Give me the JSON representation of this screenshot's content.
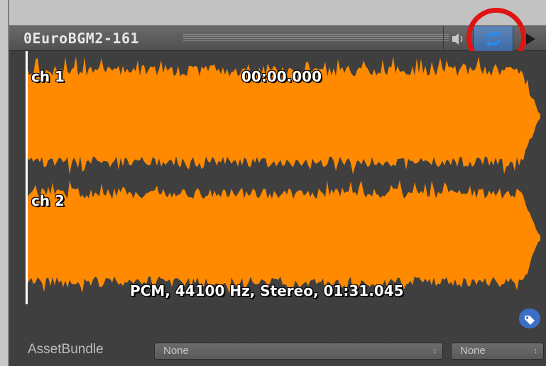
{
  "header": {
    "title": "0EuroBGM2-161",
    "buttons": [
      "mute-toggle",
      "loop-toggle",
      "play-button"
    ],
    "highlighted_button": "loop-toggle",
    "annotation": "red-circle"
  },
  "preview": {
    "channels": [
      {
        "label": "ch 1"
      },
      {
        "label": "ch 2"
      }
    ],
    "time": "00:00.000",
    "info": "PCM, 44100 Hz, Stereo, 01:31.045",
    "waveform_color": "#ff8a00",
    "background_color": "#3f3f3f"
  },
  "footer": {
    "assetbundle_label": "AssetBundle",
    "bundle_name": {
      "value": "None"
    },
    "bundle_variant": {
      "value": "None"
    },
    "tag_icon": "label-tag-icon"
  }
}
